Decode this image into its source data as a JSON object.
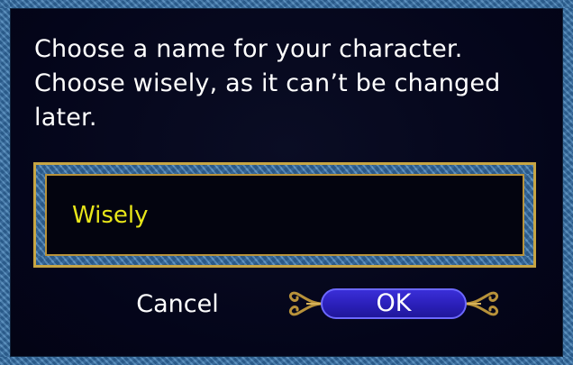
{
  "dialog": {
    "prompt_line1": "Choose a name for your character.",
    "prompt_line2": "Choose wisely, as it can’t be changed",
    "prompt_line3": "later."
  },
  "name_field": {
    "value": "Wisely"
  },
  "buttons": {
    "cancel_label": "Cancel",
    "ok_label": "OK"
  },
  "colors": {
    "frame": "#3f77a8",
    "gold_trim": "#c7a544",
    "background": "#04051a",
    "input_text": "#e8e619",
    "ok_button": "#2a1fb8"
  },
  "icons": {
    "ok_ornament": "scroll-flourish-icon"
  }
}
